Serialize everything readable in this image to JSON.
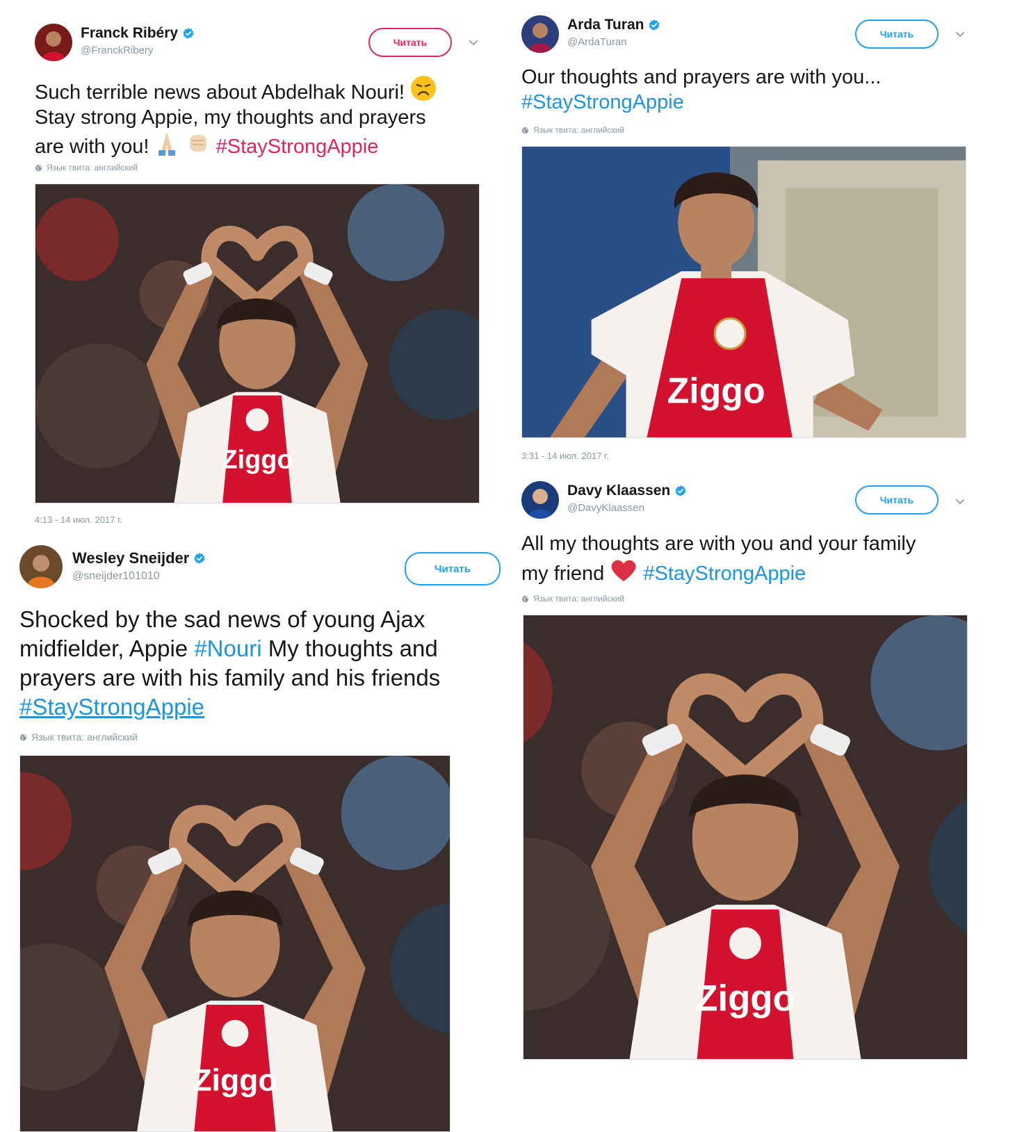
{
  "tweets": [
    {
      "author": "Franck Ribéry",
      "handle": "@FranckRibery",
      "follow_label": "Читать",
      "text_1": "Such terrible news about Abdelhak Nouri!",
      "text_2": "Stay strong Appie, my thoughts and prayers",
      "text_3": "are with you!",
      "hashtag": "#StayStrongAppie",
      "lang_note": "Язык твита: английский",
      "timestamp": "4:13 - 14 июл. 2017 г.",
      "photo_desc": "player-heart-gesture-photo"
    },
    {
      "author": "Arda Turan",
      "handle": "@ArdaTuran",
      "follow_label": "Читать",
      "text_1": "Our thoughts and prayers are with you...",
      "hashtag": "#StayStrongAppie",
      "lang_note": "Язык твита: английский",
      "timestamp": "3:31 - 14 июл. 2017 г.",
      "photo_desc": "player-running-photo"
    },
    {
      "author": "Wesley Sneijder",
      "handle": "@sneijder101010",
      "follow_label": "Читать",
      "text_1": "Shocked by the sad news of young Ajax",
      "text_2": "midfielder, Appie",
      "hashtag_mid": "#Nouri",
      "text_3": "My thoughts and",
      "text_4": "prayers are with his family and his friends",
      "hashtag": "#StayStrongAppie",
      "lang_note": "Язык твита: английский",
      "photo_desc": "player-heart-gesture-photo"
    },
    {
      "author": "Davy Klaassen",
      "handle": "@DavyKlaassen",
      "follow_label": "Читать",
      "text_1": "All my thoughts are with you and your family",
      "text_2": "my friend",
      "hashtag": "#StayStrongAppie",
      "lang_note": "Язык твита: английский",
      "photo_desc": "player-heart-gesture-photo"
    }
  ],
  "colors": {
    "twitter_blue": "#1da1f2",
    "hashtag_blue": "#1b95e0",
    "follow_red": "#e0245e",
    "ajax_red": "#d2122e",
    "muted_gray": "#8899a6"
  },
  "icons": [
    "verified-badge-icon",
    "chevron-down-icon",
    "globe-icon",
    "sad-face-emoji",
    "praying-hands-emoji",
    "fist-emoji",
    "red-heart-emoji"
  ]
}
